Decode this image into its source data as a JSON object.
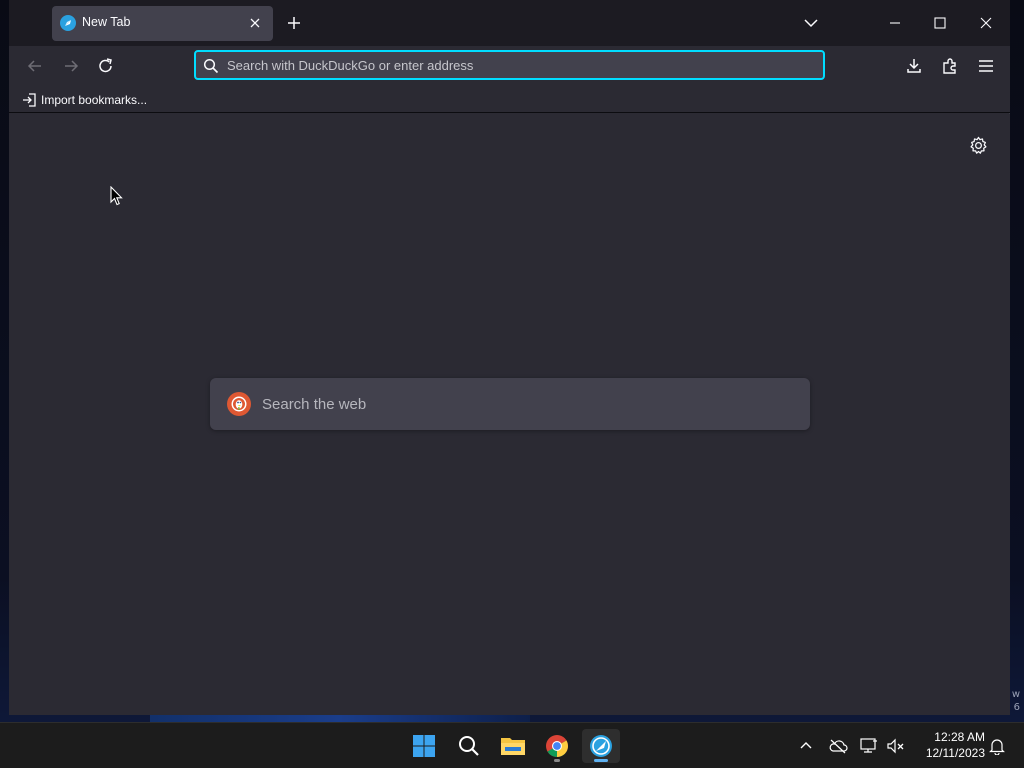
{
  "browser": {
    "tab": {
      "title": "New Tab"
    },
    "urlbar": {
      "placeholder": "Search with DuckDuckGo or enter address",
      "value": ""
    },
    "bookmarks_bar": {
      "import_label": "Import bookmarks..."
    },
    "newtab": {
      "search_placeholder": "Search the web"
    }
  },
  "taskbar": {
    "apps": [
      "start-icon",
      "search-icon",
      "file-explorer-icon",
      "chrome-icon",
      "waterfox-icon"
    ],
    "clock": {
      "time": "12:28 AM",
      "date": "12/11/2023"
    }
  },
  "desktop": {
    "corner_text": "w 6"
  },
  "colors": {
    "accent": "#00ddff",
    "tab_bg": "#42414d",
    "content_bg": "#2b2a33",
    "tabstrip_bg": "#1c1b22",
    "ddg_orange": "#de5833"
  }
}
